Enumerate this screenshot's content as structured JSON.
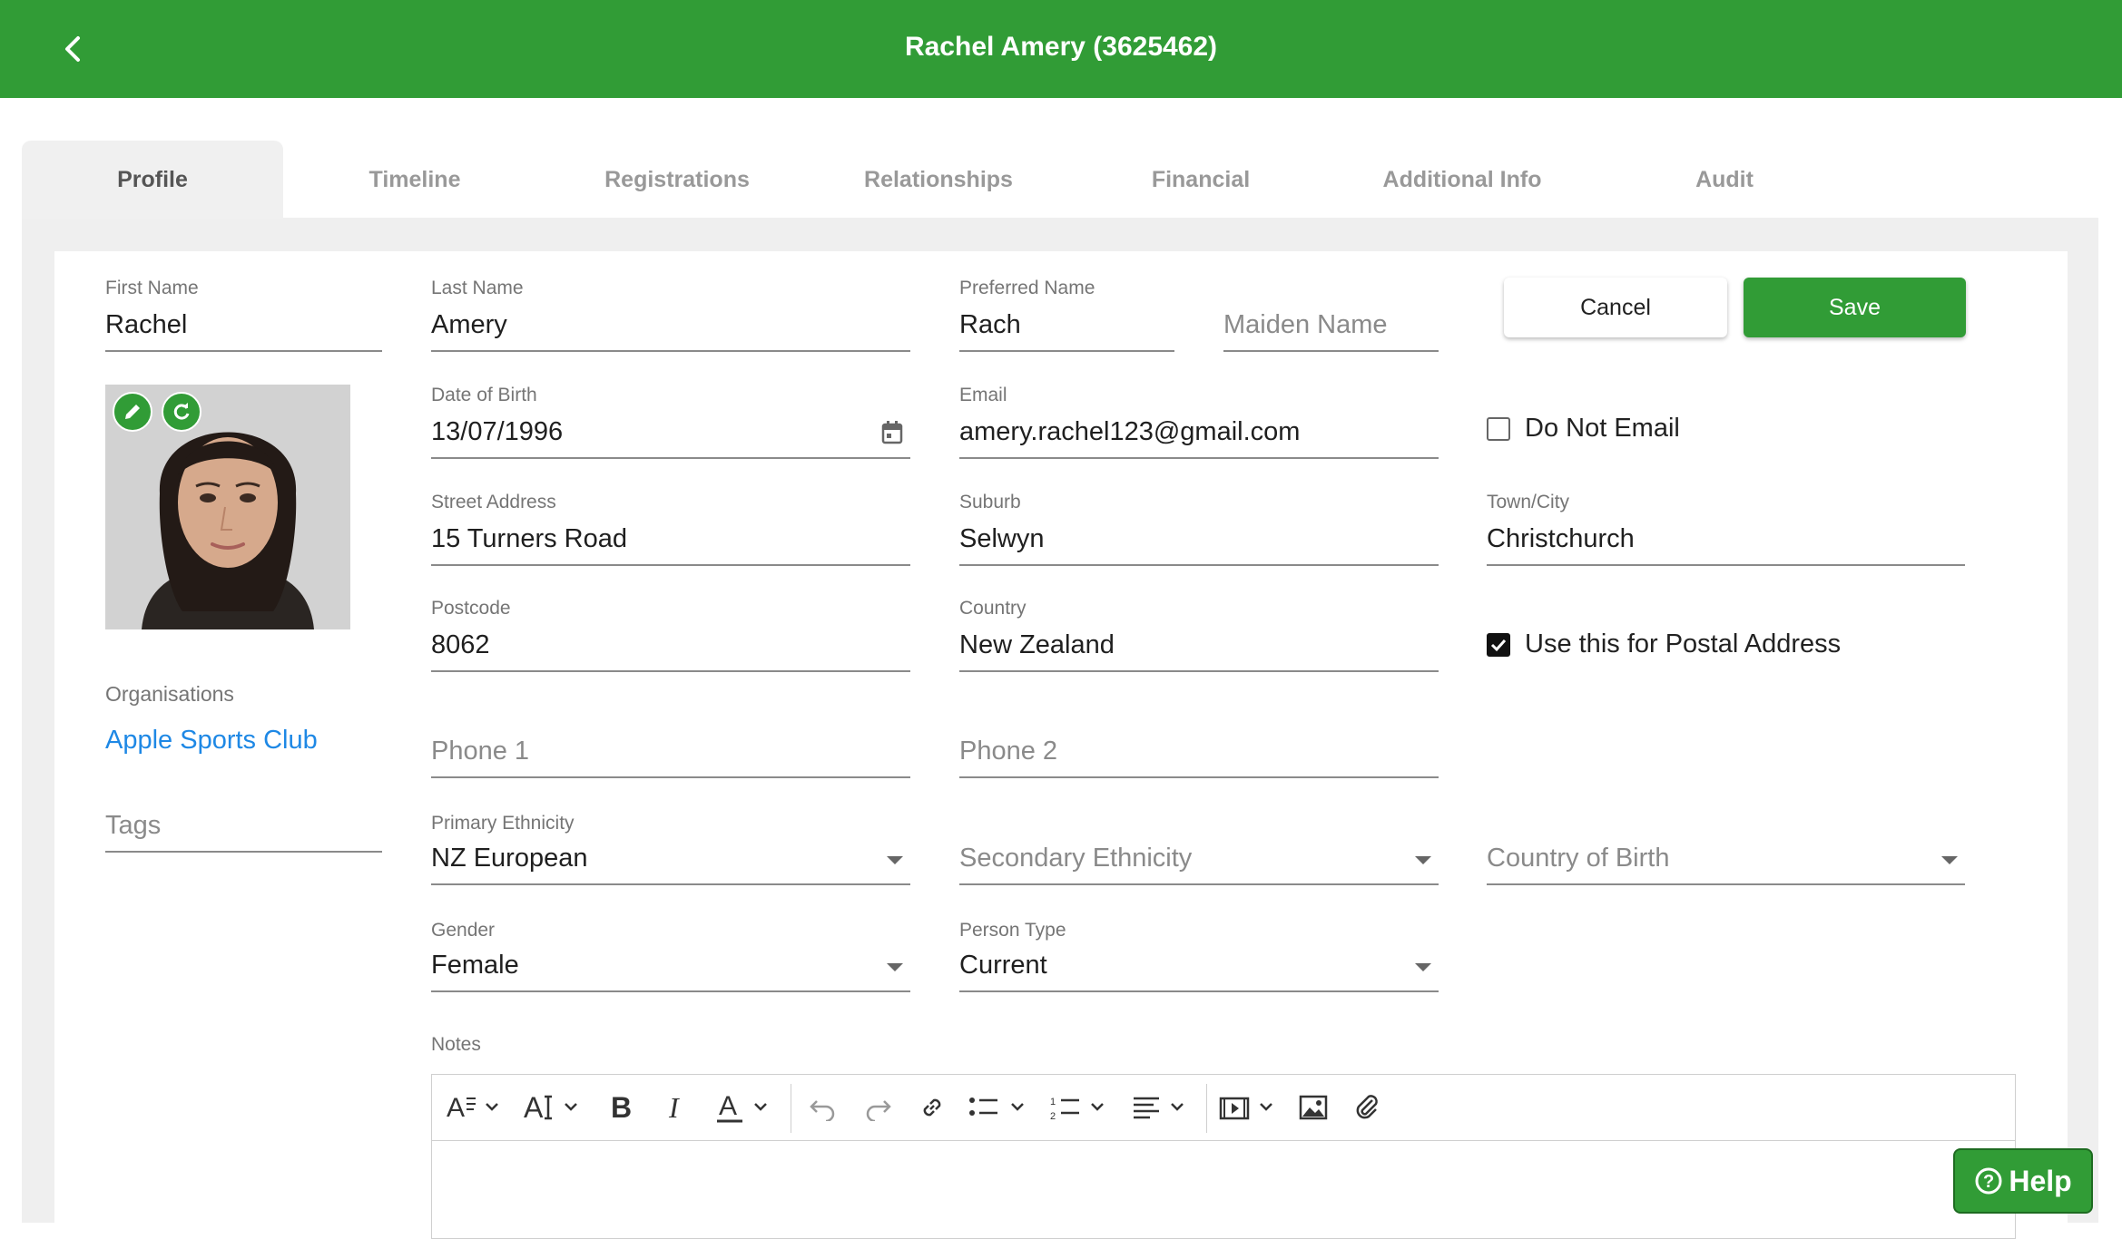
{
  "header": {
    "title": "Rachel Amery (3625462)",
    "back_icon": "chevron-left-icon"
  },
  "tabs": [
    {
      "label": "Profile",
      "active": true
    },
    {
      "label": "Timeline"
    },
    {
      "label": "Registrations"
    },
    {
      "label": "Relationships"
    },
    {
      "label": "Financial"
    },
    {
      "label": "Additional Info"
    },
    {
      "label": "Audit"
    }
  ],
  "form": {
    "first_name": {
      "label": "First Name",
      "value": "Rachel"
    },
    "last_name": {
      "label": "Last Name",
      "value": "Amery"
    },
    "preferred_name": {
      "label": "Preferred Name",
      "value": "Rach"
    },
    "maiden_name": {
      "placeholder": "Maiden Name"
    },
    "dob": {
      "label": "Date of Birth",
      "value": "13/07/1996"
    },
    "email": {
      "label": "Email",
      "value": "amery.rachel123@gmail.com"
    },
    "do_not_email": {
      "label": "Do Not Email",
      "checked": false
    },
    "street": {
      "label": "Street Address",
      "value": "15 Turners Road"
    },
    "suburb": {
      "label": "Suburb",
      "value": "Selwyn"
    },
    "town": {
      "label": "Town/City",
      "value": "Christchurch"
    },
    "postcode": {
      "label": "Postcode",
      "value": "8062"
    },
    "country": {
      "label": "Country",
      "value": "New Zealand"
    },
    "postal": {
      "label": "Use this for Postal Address",
      "checked": true
    },
    "phone1": {
      "placeholder": "Phone 1"
    },
    "phone2": {
      "placeholder": "Phone 2"
    },
    "primary_ethnicity": {
      "label": "Primary Ethnicity",
      "value": "NZ European"
    },
    "secondary_ethnicity": {
      "placeholder": "Secondary Ethnicity"
    },
    "country_of_birth": {
      "placeholder": "Country of Birth"
    },
    "gender": {
      "label": "Gender",
      "value": "Female"
    },
    "person_type": {
      "label": "Person Type",
      "value": "Current"
    },
    "tags": {
      "placeholder": "Tags"
    },
    "notes_label": "Notes"
  },
  "organisations": {
    "label": "Organisations",
    "items": [
      "Apple Sports Club"
    ]
  },
  "actions": {
    "cancel": "Cancel",
    "save": "Save"
  },
  "help": {
    "label": "Help"
  },
  "colors": {
    "brand": "#319c36",
    "link": "#1e88e5"
  }
}
